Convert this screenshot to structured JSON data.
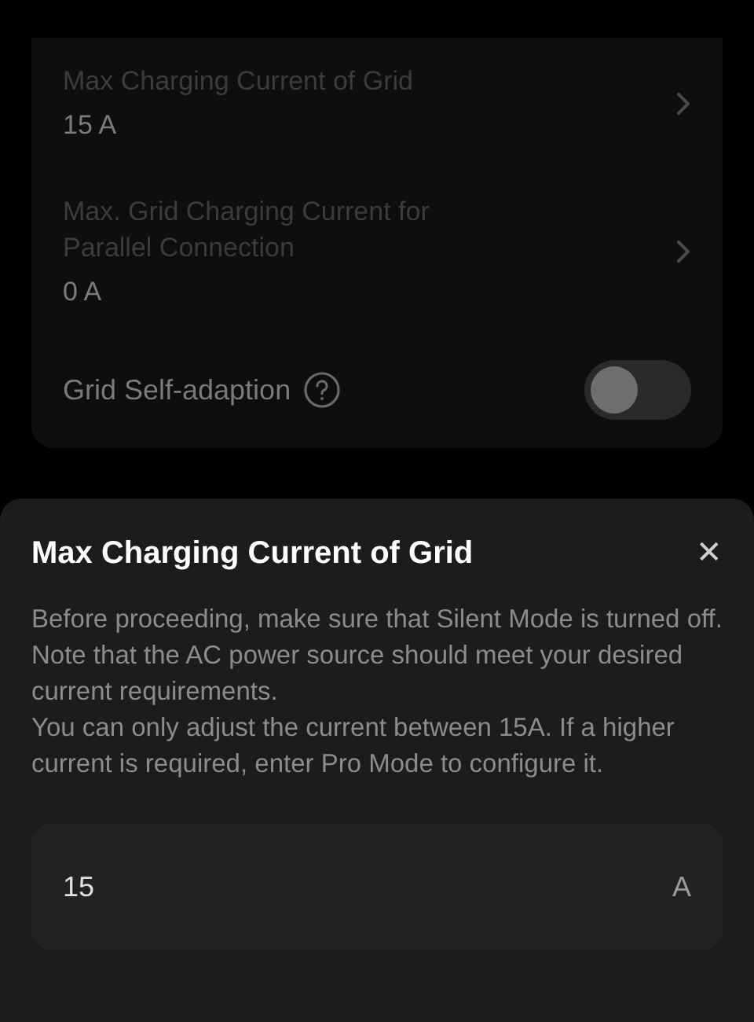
{
  "settings": [
    {
      "kind": "link",
      "label": "Max Charging Current of Grid",
      "value": "15 A"
    },
    {
      "kind": "link",
      "label": "Max. Grid Charging Current for Parallel Connection",
      "value": "0 A"
    },
    {
      "kind": "toggle",
      "label": "Grid Self-adaption",
      "on": false
    }
  ],
  "sheet": {
    "title": "Max Charging Current of Grid",
    "close": "✕",
    "paragraphs": [
      "Before proceeding, make sure that Silent Mode is turned off.",
      "Note that the AC power source should meet your desired current requirements.",
      "You can only adjust the current between 15A. If a higher current is required, enter Pro Mode to configure it."
    ],
    "field": {
      "value": "15",
      "unit": "A"
    }
  }
}
